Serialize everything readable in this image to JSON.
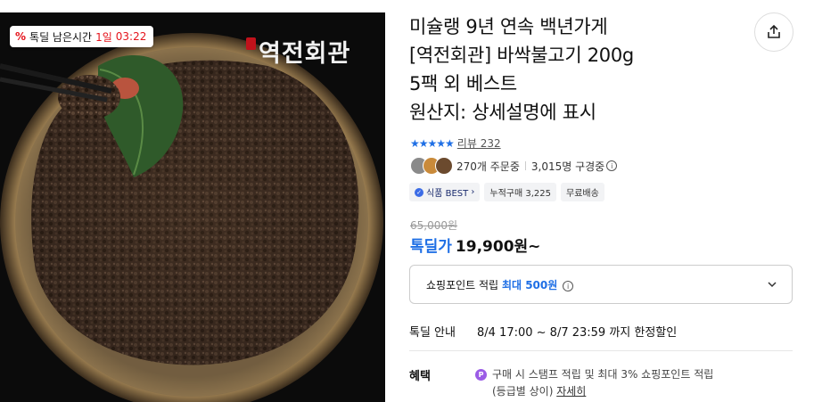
{
  "image": {
    "timer_badge": {
      "icon": "percent-icon",
      "label": "톡딜 남은시간",
      "days": "1일",
      "time": "03:22"
    },
    "brand_logo": "역전회관"
  },
  "product": {
    "title_lines": [
      "미슐랭 9년 연속 백년가게",
      "[역전회관] 바싹불고기 200g",
      "5팩 외 베스트",
      "원산지: 상세설명에 표시"
    ],
    "rating": {
      "stars": "★★★★★",
      "review_label": "리뷰 232"
    },
    "orders": {
      "count_text": "270개 주문중",
      "subscribers_text": "3,015명 구경중"
    },
    "tags": [
      "식품 BEST",
      "누적구매 3,225",
      "무료배송"
    ],
    "original_price": "65,000원",
    "sale_label": "톡딜가",
    "sale_price": "19,900원~",
    "points": {
      "prefix": "쇼핑포인트 적립",
      "highlight": "최대 500원"
    },
    "deal": {
      "label": "톡딜 안내",
      "text": "8/4 17:00 ~ 8/7 23:59 까지 한정할인"
    },
    "benefit": {
      "label": "혜택",
      "line1": "구매 시 스탬프 적립 및 최대 3% 쇼핑포인트 적립",
      "line2": "(등급별 상이)",
      "link": "자세히"
    }
  },
  "colors": {
    "accent_blue": "#1f6fe5",
    "deal_red": "#e5141c",
    "point_purple": "#9b5ce6"
  },
  "icons": {
    "share": "share-icon",
    "chevron": "chevron-down-icon",
    "info": "info-icon"
  }
}
